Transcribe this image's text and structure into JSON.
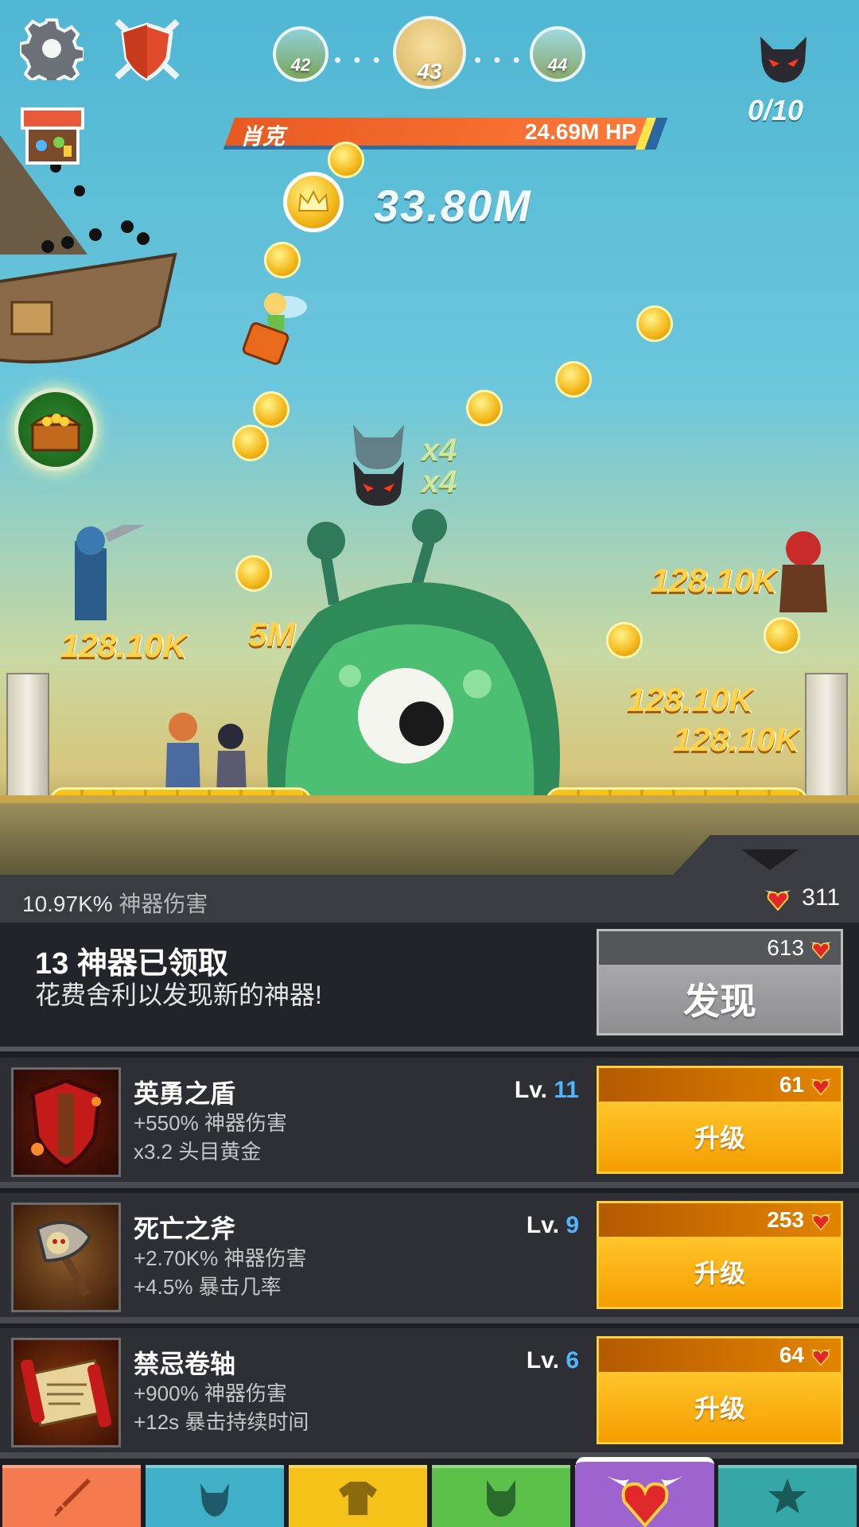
{
  "hud": {
    "stages": {
      "prev": "42",
      "current": "43",
      "next": "44"
    },
    "boss_kills": "0/10",
    "boss_name": "肖克",
    "boss_hp": "24.69M HP",
    "gold": "33.80M"
  },
  "battle": {
    "damage_texts": [
      "128.10K",
      "128.10K",
      "128.10K",
      "128.10K",
      "5M"
    ],
    "multipliers": [
      "x4",
      "x4"
    ]
  },
  "stats": {
    "artifact_damage_value": "10.97K%",
    "artifact_damage_label": "神器伤害",
    "relics": "311"
  },
  "discover": {
    "title": "13 神器已领取",
    "description": "花费舍利以发现新的神器!",
    "cost": "613",
    "button_label": "发现"
  },
  "artifacts": [
    {
      "name": "英勇之盾",
      "stat1": "+550% 神器伤害",
      "stat2": "x3.2 头目黄金",
      "lv_prefix": "Lv.",
      "level": "11",
      "cost": "61",
      "button": "升级"
    },
    {
      "name": "死亡之斧",
      "stat1": "+2.70K% 神器伤害",
      "stat2": "+4.5% 暴击几率",
      "lv_prefix": "Lv.",
      "level": "9",
      "cost": "253",
      "button": "升级"
    },
    {
      "name": "禁忌卷轴",
      "stat1": "+900% 神器伤害",
      "stat2": "+12s 暴击持续时间",
      "lv_prefix": "Lv.",
      "level": "6",
      "cost": "64",
      "button": "升级"
    }
  ],
  "nav": {
    "tabs": [
      {
        "name": "sword",
        "color": "#f47a4f"
      },
      {
        "name": "hero",
        "color": "#3fb0c8"
      },
      {
        "name": "equipment",
        "color": "#f5c21a"
      },
      {
        "name": "pet",
        "color": "#5cc14a"
      },
      {
        "name": "artifact",
        "color": "#9d64d0"
      },
      {
        "name": "shop",
        "color": "#36a7a7"
      }
    ],
    "active": "artifact"
  }
}
